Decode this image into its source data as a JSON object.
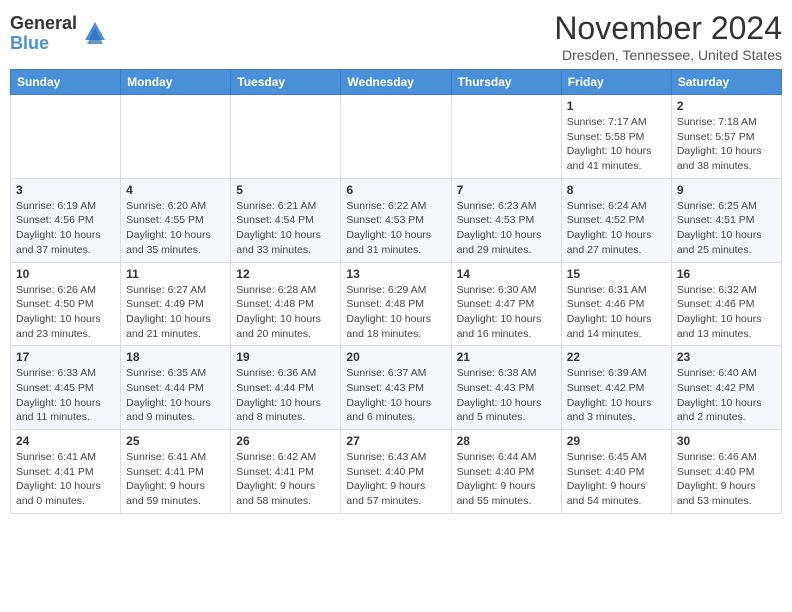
{
  "header": {
    "logo_general": "General",
    "logo_blue": "Blue",
    "month_title": "November 2024",
    "location": "Dresden, Tennessee, United States"
  },
  "weekdays": [
    "Sunday",
    "Monday",
    "Tuesday",
    "Wednesday",
    "Thursday",
    "Friday",
    "Saturday"
  ],
  "weeks": [
    [
      {
        "day": "",
        "info": ""
      },
      {
        "day": "",
        "info": ""
      },
      {
        "day": "",
        "info": ""
      },
      {
        "day": "",
        "info": ""
      },
      {
        "day": "",
        "info": ""
      },
      {
        "day": "1",
        "info": "Sunrise: 7:17 AM\nSunset: 5:58 PM\nDaylight: 10 hours and 41 minutes."
      },
      {
        "day": "2",
        "info": "Sunrise: 7:18 AM\nSunset: 5:57 PM\nDaylight: 10 hours and 38 minutes."
      }
    ],
    [
      {
        "day": "3",
        "info": "Sunrise: 6:19 AM\nSunset: 4:56 PM\nDaylight: 10 hours and 37 minutes."
      },
      {
        "day": "4",
        "info": "Sunrise: 6:20 AM\nSunset: 4:55 PM\nDaylight: 10 hours and 35 minutes."
      },
      {
        "day": "5",
        "info": "Sunrise: 6:21 AM\nSunset: 4:54 PM\nDaylight: 10 hours and 33 minutes."
      },
      {
        "day": "6",
        "info": "Sunrise: 6:22 AM\nSunset: 4:53 PM\nDaylight: 10 hours and 31 minutes."
      },
      {
        "day": "7",
        "info": "Sunrise: 6:23 AM\nSunset: 4:53 PM\nDaylight: 10 hours and 29 minutes."
      },
      {
        "day": "8",
        "info": "Sunrise: 6:24 AM\nSunset: 4:52 PM\nDaylight: 10 hours and 27 minutes."
      },
      {
        "day": "9",
        "info": "Sunrise: 6:25 AM\nSunset: 4:51 PM\nDaylight: 10 hours and 25 minutes."
      }
    ],
    [
      {
        "day": "10",
        "info": "Sunrise: 6:26 AM\nSunset: 4:50 PM\nDaylight: 10 hours and 23 minutes."
      },
      {
        "day": "11",
        "info": "Sunrise: 6:27 AM\nSunset: 4:49 PM\nDaylight: 10 hours and 21 minutes."
      },
      {
        "day": "12",
        "info": "Sunrise: 6:28 AM\nSunset: 4:48 PM\nDaylight: 10 hours and 20 minutes."
      },
      {
        "day": "13",
        "info": "Sunrise: 6:29 AM\nSunset: 4:48 PM\nDaylight: 10 hours and 18 minutes."
      },
      {
        "day": "14",
        "info": "Sunrise: 6:30 AM\nSunset: 4:47 PM\nDaylight: 10 hours and 16 minutes."
      },
      {
        "day": "15",
        "info": "Sunrise: 6:31 AM\nSunset: 4:46 PM\nDaylight: 10 hours and 14 minutes."
      },
      {
        "day": "16",
        "info": "Sunrise: 6:32 AM\nSunset: 4:46 PM\nDaylight: 10 hours and 13 minutes."
      }
    ],
    [
      {
        "day": "17",
        "info": "Sunrise: 6:33 AM\nSunset: 4:45 PM\nDaylight: 10 hours and 11 minutes."
      },
      {
        "day": "18",
        "info": "Sunrise: 6:35 AM\nSunset: 4:44 PM\nDaylight: 10 hours and 9 minutes."
      },
      {
        "day": "19",
        "info": "Sunrise: 6:36 AM\nSunset: 4:44 PM\nDaylight: 10 hours and 8 minutes."
      },
      {
        "day": "20",
        "info": "Sunrise: 6:37 AM\nSunset: 4:43 PM\nDaylight: 10 hours and 6 minutes."
      },
      {
        "day": "21",
        "info": "Sunrise: 6:38 AM\nSunset: 4:43 PM\nDaylight: 10 hours and 5 minutes."
      },
      {
        "day": "22",
        "info": "Sunrise: 6:39 AM\nSunset: 4:42 PM\nDaylight: 10 hours and 3 minutes."
      },
      {
        "day": "23",
        "info": "Sunrise: 6:40 AM\nSunset: 4:42 PM\nDaylight: 10 hours and 2 minutes."
      }
    ],
    [
      {
        "day": "24",
        "info": "Sunrise: 6:41 AM\nSunset: 4:41 PM\nDaylight: 10 hours and 0 minutes."
      },
      {
        "day": "25",
        "info": "Sunrise: 6:41 AM\nSunset: 4:41 PM\nDaylight: 9 hours and 59 minutes."
      },
      {
        "day": "26",
        "info": "Sunrise: 6:42 AM\nSunset: 4:41 PM\nDaylight: 9 hours and 58 minutes."
      },
      {
        "day": "27",
        "info": "Sunrise: 6:43 AM\nSunset: 4:40 PM\nDaylight: 9 hours and 57 minutes."
      },
      {
        "day": "28",
        "info": "Sunrise: 6:44 AM\nSunset: 4:40 PM\nDaylight: 9 hours and 55 minutes."
      },
      {
        "day": "29",
        "info": "Sunrise: 6:45 AM\nSunset: 4:40 PM\nDaylight: 9 hours and 54 minutes."
      },
      {
        "day": "30",
        "info": "Sunrise: 6:46 AM\nSunset: 4:40 PM\nDaylight: 9 hours and 53 minutes."
      }
    ]
  ]
}
